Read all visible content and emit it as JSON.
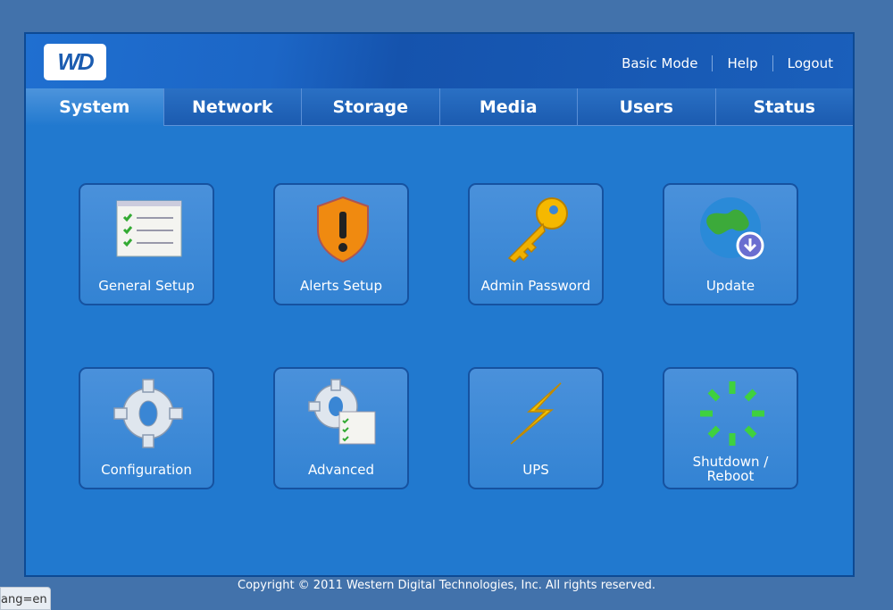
{
  "header": {
    "logo": "WD",
    "links": [
      "Basic Mode",
      "Help",
      "Logout"
    ]
  },
  "tabs": [
    "System",
    "Network",
    "Storage",
    "Media",
    "Users",
    "Status"
  ],
  "active_tab": "System",
  "tiles": [
    {
      "label": "General Setup",
      "icon": "checklist-icon"
    },
    {
      "label": "Alerts Setup",
      "icon": "shield-alert-icon"
    },
    {
      "label": "Admin Password",
      "icon": "key-icon"
    },
    {
      "label": "Update",
      "icon": "globe-download-icon"
    },
    {
      "label": "Configuration",
      "icon": "gear-icon"
    },
    {
      "label": "Advanced",
      "icon": "gear-checklist-icon"
    },
    {
      "label": "UPS",
      "icon": "lightning-icon"
    },
    {
      "label": "Shutdown / Reboot",
      "icon": "spinner-icon"
    }
  ],
  "footer": {
    "copyright": "Copyright © 2011 Western Digital Technologies, Inc. All rights reserved."
  },
  "statusbar": {
    "text": "ang=en"
  }
}
